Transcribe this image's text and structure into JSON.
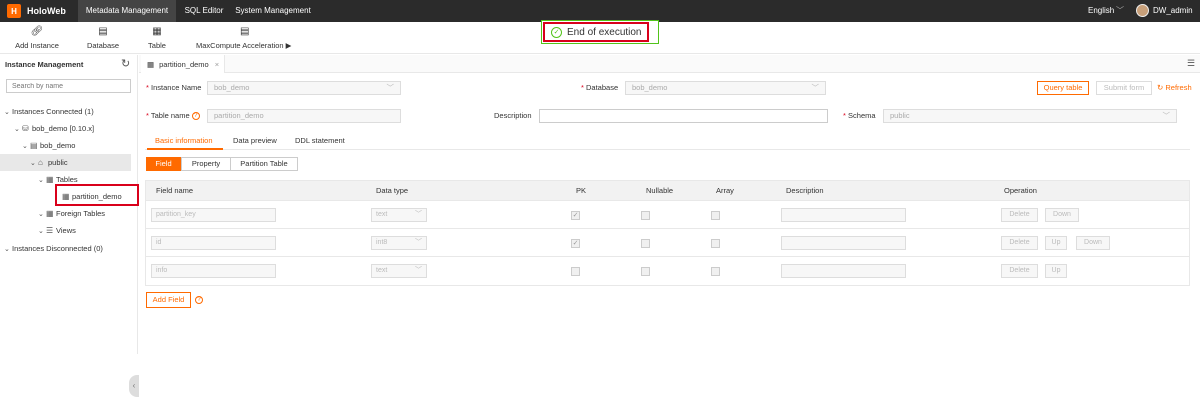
{
  "topbar": {
    "logo_text": "HoloWeb",
    "nav": [
      "Metadata Management",
      "SQL Editor",
      "System Management"
    ],
    "language": "English",
    "user": "DW_admin"
  },
  "toolbar": {
    "items": [
      "Add Instance",
      "Database",
      "Table",
      "MaxCompute Acceleration"
    ]
  },
  "toast": {
    "text": "End of execution"
  },
  "sidebar": {
    "title": "Instance Management",
    "search_placeholder": "Search by name",
    "tree": {
      "connected": "Instances Connected (1)",
      "instance": "bob_demo [0.10.x]",
      "database": "bob_demo",
      "schema": "public",
      "tables": "Tables",
      "table": "partition_demo",
      "foreign_tables": "Foreign Tables",
      "views": "Views",
      "disconnected": "Instances Disconnected (0)"
    }
  },
  "tab": {
    "label": "partition_demo"
  },
  "form": {
    "instance_label": "Instance Name",
    "instance_value": "bob_demo",
    "database_label": "Database",
    "database_value": "bob_demo",
    "table_label": "Table name",
    "table_value": "partition_demo",
    "description_label": "Description",
    "schema_label": "Schema",
    "schema_value": "public",
    "query_button": "Query table",
    "submit_button": "Submit form",
    "refresh_button": "Refresh"
  },
  "subtabs": [
    "Basic information",
    "Data preview",
    "DDL statement"
  ],
  "segments": [
    "Field",
    "Property",
    "Partition Table"
  ],
  "table": {
    "headers": [
      "Field name",
      "Data type",
      "PK",
      "Nullable",
      "Array",
      "Description",
      "Operation"
    ],
    "rows": [
      {
        "name": "partition_key",
        "type": "text",
        "pk": true,
        "nullable": false,
        "array": false,
        "ops": [
          "Delete",
          "Down"
        ]
      },
      {
        "name": "id",
        "type": "int8",
        "pk": true,
        "nullable": false,
        "array": false,
        "ops": [
          "Delete",
          "Up",
          "Down"
        ]
      },
      {
        "name": "info",
        "type": "text",
        "pk": false,
        "nullable": false,
        "array": false,
        "ops": [
          "Delete",
          "Up"
        ]
      }
    ]
  },
  "add_field_button": "Add Field"
}
